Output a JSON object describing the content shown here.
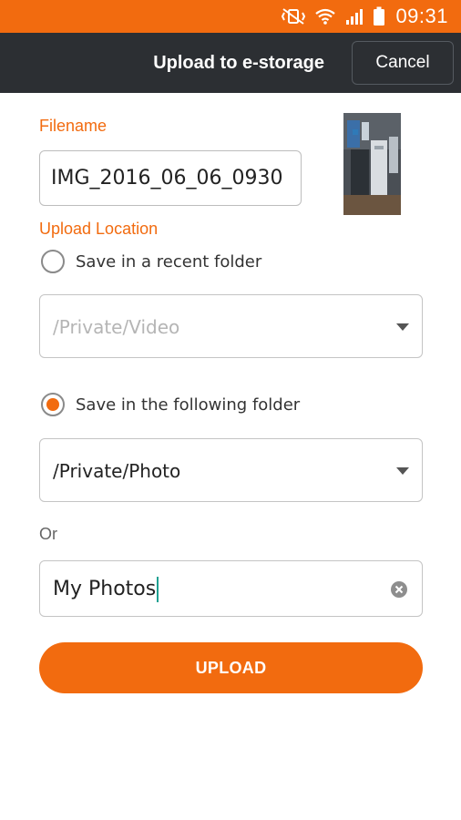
{
  "status_bar": {
    "time": "09:31",
    "icons": [
      "vibrate-mute-icon",
      "wifi-icon",
      "signal-icon",
      "battery-icon"
    ]
  },
  "app_bar": {
    "title": "Upload to e-storage",
    "cancel_label": "Cancel"
  },
  "form": {
    "filename_label": "Filename",
    "filename_value": "IMG_2016_06_06_0930",
    "upload_location_label": "Upload Location",
    "recent_option_label": "Save in a recent folder",
    "recent_folder_value": "/Private/Video",
    "recent_option_checked": false,
    "following_option_label": "Save in the following folder",
    "following_folder_value": "/Private/Photo",
    "following_option_checked": true,
    "or_label": "Or",
    "new_folder_value": "My Photos",
    "upload_label": "UPLOAD"
  },
  "colors": {
    "accent": "#f26b0f",
    "app_bar": "#2c2f33",
    "cursor": "#1fa192"
  }
}
